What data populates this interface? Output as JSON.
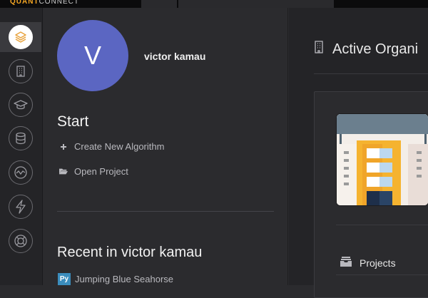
{
  "topbar": {
    "logo_main": "QUANT",
    "logo_thin": "CONNECT"
  },
  "sidebar": {
    "items": [
      {
        "name": "sidebar-item-projects",
        "icon": "layers-icon",
        "active": true
      },
      {
        "name": "sidebar-item-organization",
        "icon": "building-icon",
        "active": false
      },
      {
        "name": "sidebar-item-learning",
        "icon": "graduation-cap-icon",
        "active": false
      },
      {
        "name": "sidebar-item-data",
        "icon": "database-icon",
        "active": false
      },
      {
        "name": "sidebar-item-research",
        "icon": "chart-circle-icon",
        "active": false
      },
      {
        "name": "sidebar-item-live",
        "icon": "lightning-icon",
        "active": false
      },
      {
        "name": "sidebar-item-support",
        "icon": "lifebuoy-icon",
        "active": false
      }
    ]
  },
  "profile": {
    "avatar_letter": "V",
    "avatar_color": "#5b66c2",
    "username": "victor kamau"
  },
  "start": {
    "heading": "Start",
    "create_label": "Create New Algorithm",
    "open_label": "Open Project"
  },
  "recent": {
    "heading": "Recent in victor kamau",
    "items": [
      {
        "badge": "Py",
        "label": "Jumping Blue Seahorse"
      }
    ]
  },
  "organization": {
    "title": "Active Organi",
    "projects_label": "Projects"
  },
  "colors": {
    "accent": "#f5a623",
    "python_badge": "#3b8dbd"
  }
}
